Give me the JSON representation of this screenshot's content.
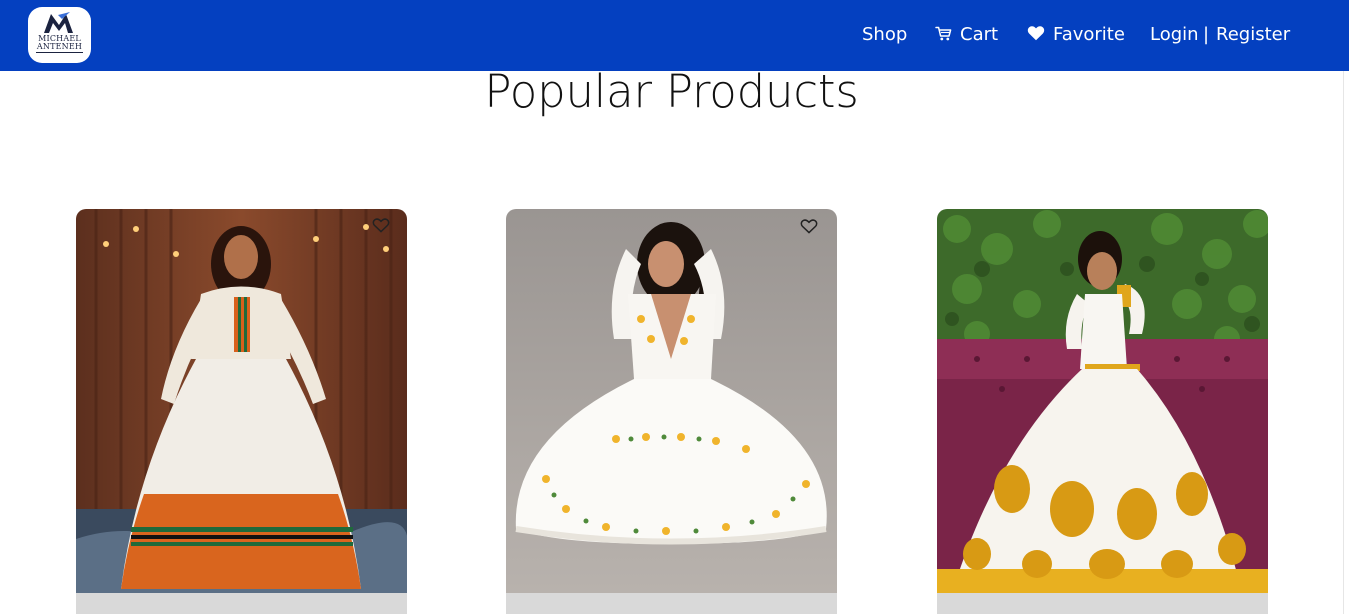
{
  "brand": {
    "logo_line1": "MICHAEL",
    "logo_line2": "ANTENEH"
  },
  "nav": {
    "shop": "Shop",
    "cart": "Cart",
    "favorite": "Favorite",
    "login": "Login",
    "separator": "|",
    "register": "Register"
  },
  "main": {
    "title": "Popular Products"
  },
  "products": [
    {
      "image": "orange-striped-dress",
      "favorite_icon": "heart-outline-icon"
    },
    {
      "image": "white-floral-dress",
      "favorite_icon": "heart-outline-icon"
    },
    {
      "image": "white-gold-embroidered-dress",
      "favorite_icon": "heart-outline-icon"
    }
  ],
  "colors": {
    "navbar": "#0440c0",
    "card_footer": "#d9d9d9"
  }
}
